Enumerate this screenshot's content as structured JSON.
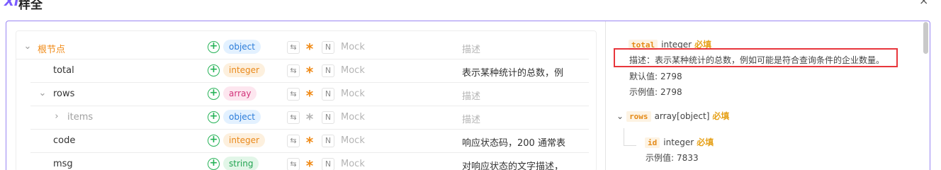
{
  "header": {
    "logo": "XI",
    "title": "样全",
    "close": "×"
  },
  "tree": {
    "mock_placeholder": "Mock",
    "rows": [
      {
        "name": "根节点",
        "type": "object",
        "description": "描述"
      },
      {
        "name": "total",
        "type": "integer",
        "description": "表示某种统计的总数，例"
      },
      {
        "name": "rows",
        "type": "array",
        "description": "描述"
      },
      {
        "name": "items",
        "type": "object",
        "description": "描述"
      },
      {
        "name": "code",
        "type": "integer",
        "description": "响应状态码，200 通常表"
      },
      {
        "name": "msg",
        "type": "string",
        "description": "对响应状态的文字描述，"
      }
    ],
    "icons": {
      "add": "+",
      "swap": "⇆",
      "required": "*",
      "nullable": "N",
      "collapse": "⌄",
      "expand": "›"
    }
  },
  "detail": {
    "required_label": "必填",
    "total": {
      "name": "total",
      "type": "integer",
      "description": "描述：表示某种统计的总数，例如可能是符合查询条件的企业数量。",
      "default_label": "默认值:",
      "default_value": "2798",
      "example_label": "示例值:",
      "example_value": "2798"
    },
    "rows": {
      "name": "rows",
      "type": "array[object]"
    },
    "id": {
      "name": "id",
      "type": "integer",
      "example_label": "示例值:",
      "example_value": "7833"
    }
  },
  "colors": {
    "accent": "#9a86f3",
    "required": "#f08a16",
    "highlight": "#e8363c"
  }
}
